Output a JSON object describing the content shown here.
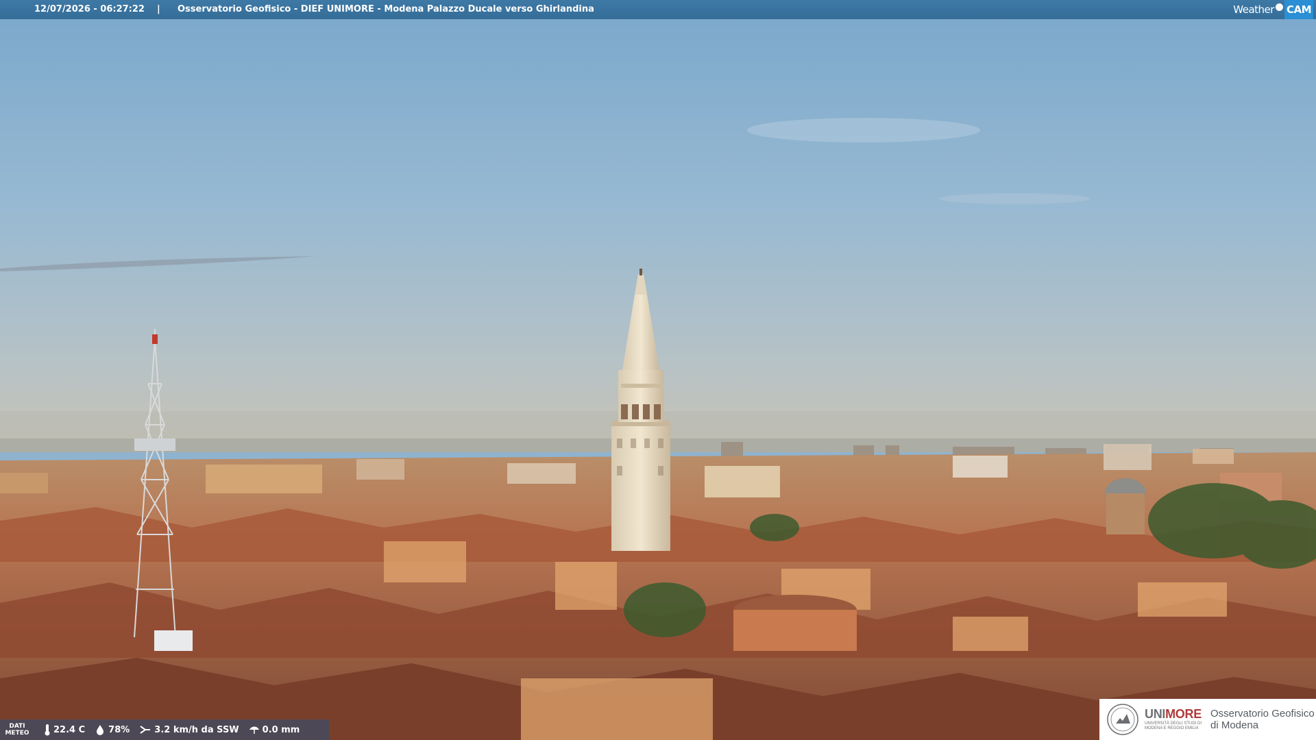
{
  "topbar": {
    "timestamp": "12/07/2026 - 06:27:22",
    "separator": "|",
    "location": "Osservatorio Geofisico - DIEF UNIMORE - Modena Palazzo Ducale verso Ghirlandina"
  },
  "brand": {
    "weather": "Weather",
    "cam": "CAM"
  },
  "meteo": {
    "label_line1": "DATI",
    "label_line2": "METEO",
    "temperature": "22.4 C",
    "humidity": "78%",
    "wind": "3.2 km/h da SSW",
    "rain": "0.0 mm"
  },
  "logo": {
    "uni_prefix": "UNI",
    "uni_suffix": "MORE",
    "uni_sub": "UNIVERSITÀ DEGLI STUDI DI MODENA E REGGIO EMILIA",
    "obs_line1": "Osservatorio Geofisico",
    "obs_line2": "di Modena"
  },
  "colors": {
    "sky_top": "#7fa9cc",
    "sky_bottom": "#c7c7bd",
    "roofs": "#b86a47",
    "tower_stone": "#eae0cc",
    "topbar": "#3a74a0",
    "logo_red": "#b03a3a"
  }
}
